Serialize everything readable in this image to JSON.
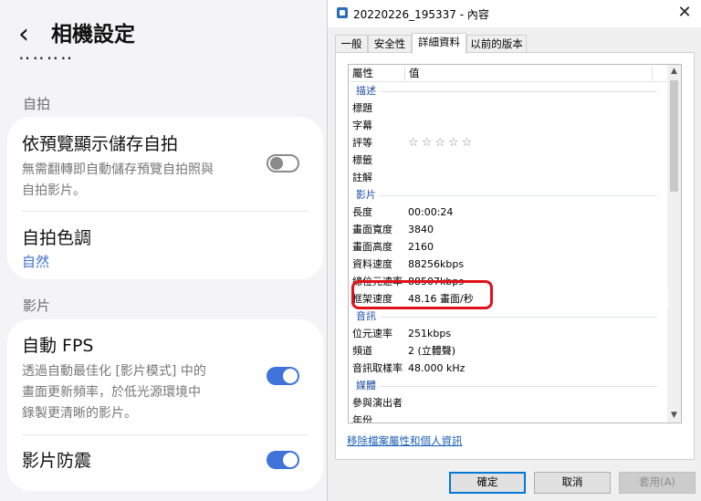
{
  "phone": {
    "header": {
      "back_icon": "chevron-left-icon",
      "back_glyph": "‹",
      "title": "相機設定"
    },
    "sections": {
      "selfie": {
        "label": "自拍"
      },
      "video": {
        "label": "影片"
      }
    },
    "items": {
      "save_preview": {
        "title": "依預覽顯示儲存自拍",
        "desc_line1": "無需翻轉即自動儲存預覽自拍照與",
        "desc_line2": "自拍影片。",
        "toggle": "off"
      },
      "selfie_tone": {
        "title": "自拍色調",
        "value": "自然"
      },
      "auto_fps": {
        "title": "自動 FPS",
        "desc_line1": "透過自動最佳化 [影片模式] 中的",
        "desc_line2": "畫面更新頻率，於低光源環境中",
        "desc_line3": "錄製更清晰的影片。",
        "toggle": "on"
      },
      "stabilization": {
        "title": "影片防震",
        "toggle": "on"
      }
    },
    "colors": {
      "accent": "#3e73d9",
      "value_text": "#3d6fcf",
      "background": "#f4f4f6"
    }
  },
  "dialog": {
    "title": "20220226_195337 - 內容",
    "close_glyph": "✕",
    "tabs": [
      "一般",
      "安全性",
      "詳細資料",
      "以前的版本"
    ],
    "active_tab": "詳細資料",
    "columns": {
      "property": "屬性",
      "value": "值"
    },
    "groups": {
      "description": {
        "label": "描述",
        "rows": [
          {
            "k": "標題",
            "v": ""
          },
          {
            "k": "字幕",
            "v": ""
          },
          {
            "k": "評等",
            "v": "☆☆☆☆☆"
          },
          {
            "k": "標籤",
            "v": ""
          },
          {
            "k": "註解",
            "v": ""
          }
        ]
      },
      "video": {
        "label": "影片",
        "rows": [
          {
            "k": "長度",
            "v": "00:00:24"
          },
          {
            "k": "畫面寬度",
            "v": "3840"
          },
          {
            "k": "畫面高度",
            "v": "2160"
          },
          {
            "k": "資料速度",
            "v": "88256kbps"
          },
          {
            "k": "總位元速率",
            "v": "88507kbps"
          },
          {
            "k": "框架速度",
            "v": "48.16 畫面/秒"
          }
        ]
      },
      "audio": {
        "label": "音訊",
        "rows": [
          {
            "k": "位元速率",
            "v": "251kbps"
          },
          {
            "k": "頻道",
            "v": "2 (立體聲)"
          },
          {
            "k": "音訊取樣率",
            "v": "48.000 kHz"
          }
        ]
      },
      "media": {
        "label": "媒體",
        "rows": [
          {
            "k": "參與演出者",
            "v": ""
          },
          {
            "k": "年份",
            "v": ""
          }
        ]
      }
    },
    "highlighted_row": "框架速度",
    "scroll": {
      "up_glyph": "▲",
      "down_glyph": "▼"
    },
    "remove_link": "移除檔案屬性和個人資訊",
    "buttons": {
      "ok": "確定",
      "cancel": "取消",
      "apply": "套用(A)"
    },
    "colors": {
      "highlight_border": "#e0111a",
      "group_label": "#1e4fa3",
      "link": "#1a5fb4"
    }
  }
}
